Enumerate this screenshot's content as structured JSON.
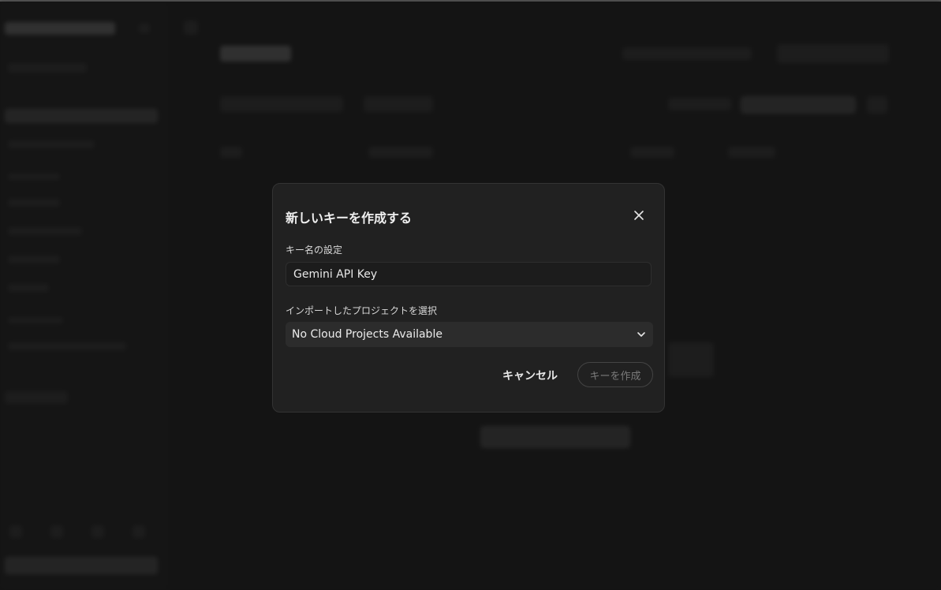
{
  "dialog": {
    "title": "新しいキーを作成する",
    "name_label": "キー名の設定",
    "name_value": "Gemini API Key",
    "project_label": "インポートしたプロジェクトを選択",
    "project_selected": "No Cloud Projects Available",
    "cancel_label": "キャンセル",
    "create_label": "キーを作成"
  },
  "icons": {
    "close": "close-icon",
    "dropdown": "chevron-down-icon"
  },
  "colors": {
    "page_bg": "#1b1b1b",
    "dialog_bg": "#212121",
    "select_bg": "#2c2c2c",
    "disabled_text": "#7a7a7a"
  }
}
